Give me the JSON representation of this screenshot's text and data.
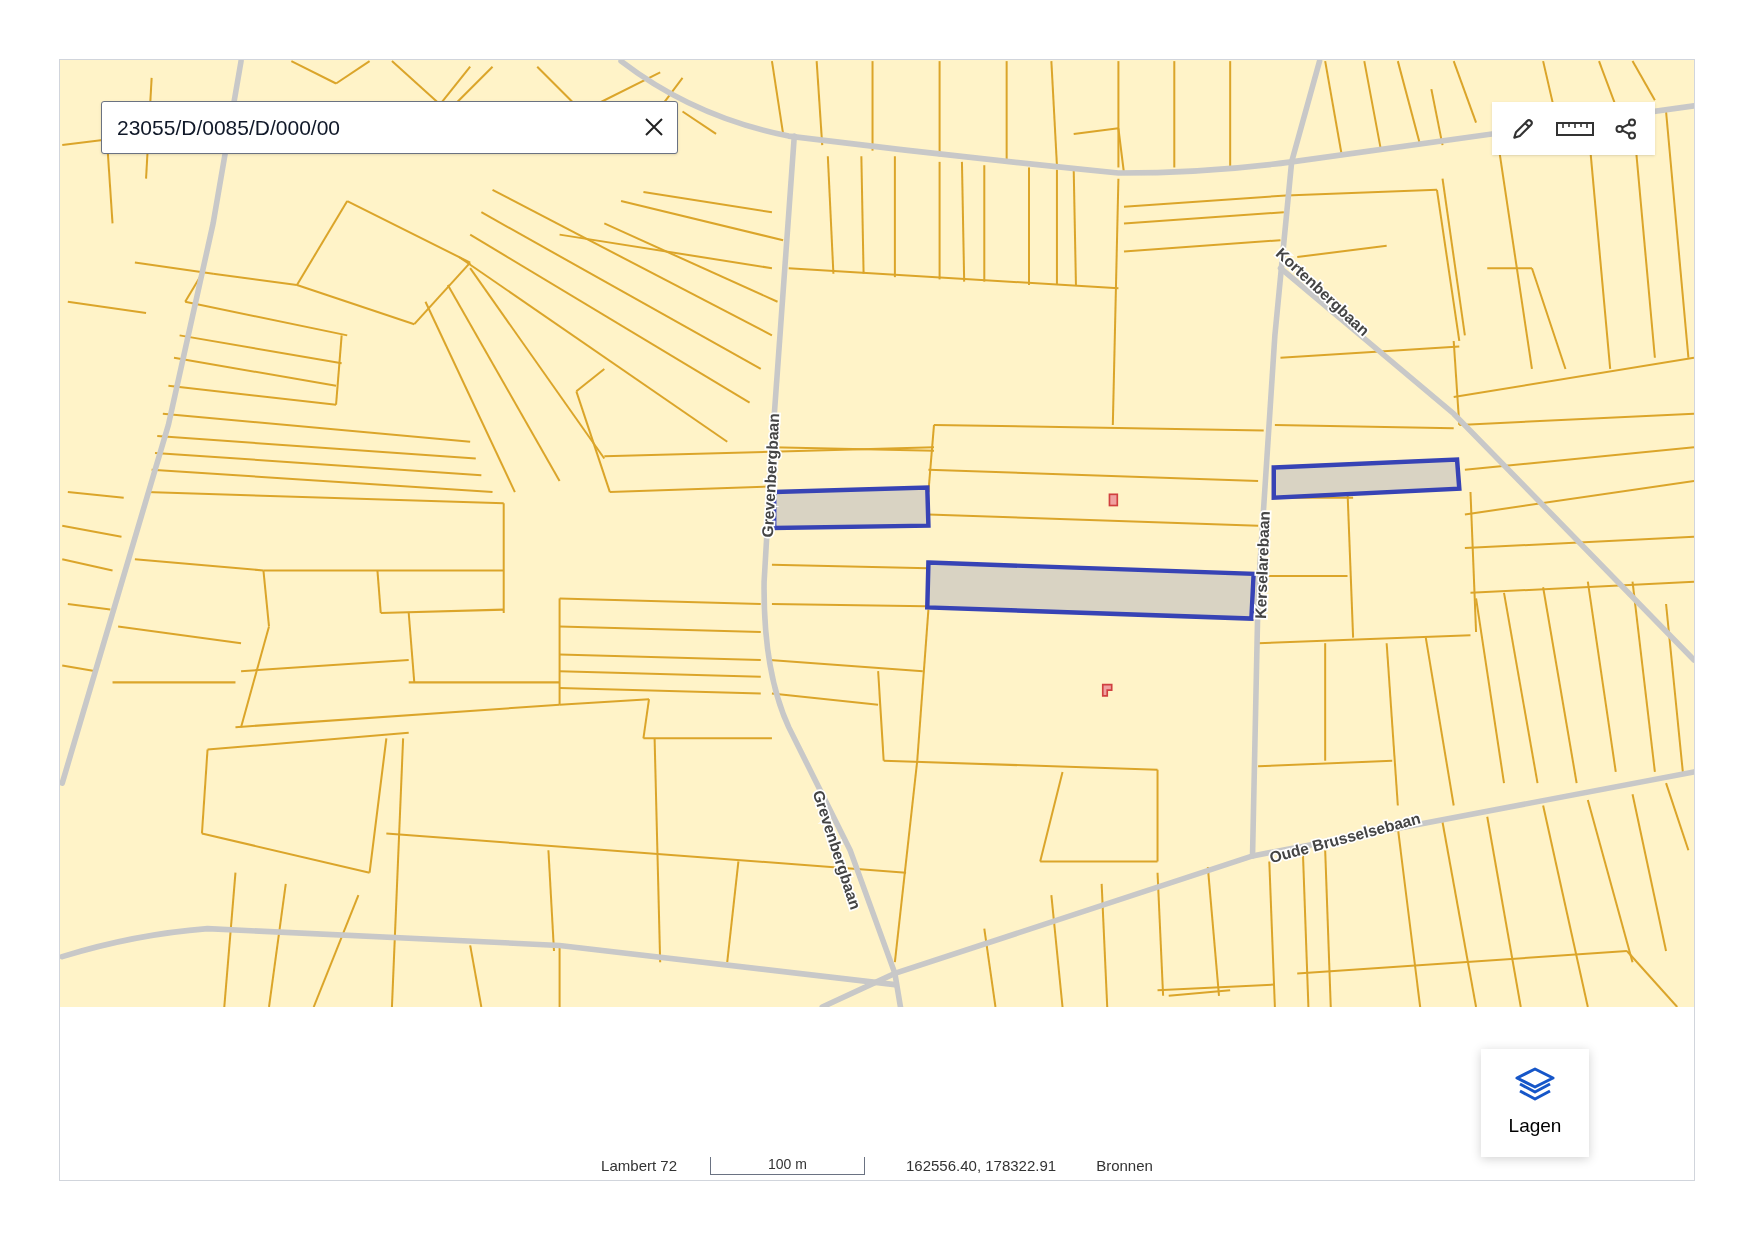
{
  "search": {
    "value": "23055/D/0085/D/000/00"
  },
  "map": {
    "road_labels": [
      "Grevenbergbaan",
      "Grevenbergbaan",
      "Kortenbergbaan",
      "Kerselarebaan",
      "Oude Brusselsebaan"
    ]
  },
  "layers_button": {
    "label": "Lagen"
  },
  "status_bar": {
    "projection": "Lambert 72",
    "scale": "100 m",
    "coordinates": "162556.40, 178322.91",
    "sources": "Bronnen"
  }
}
